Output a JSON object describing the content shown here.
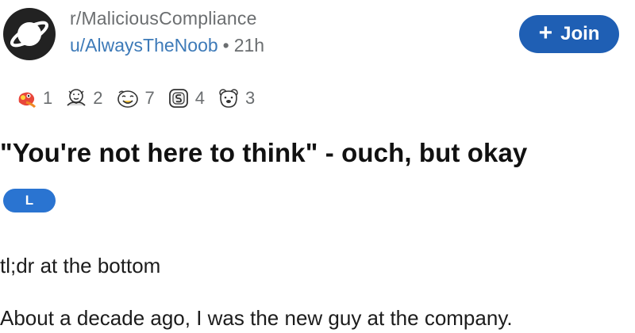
{
  "header": {
    "subreddit": "r/MaliciousCompliance",
    "author": "u/AlwaysTheNoob",
    "separator": "•",
    "age": "21h",
    "join_label": "Join",
    "join_icon": "plus-icon"
  },
  "awards": [
    {
      "icon": "wholesome-seal-award-icon",
      "count": "1"
    },
    {
      "icon": "hug-award-icon",
      "count": "2"
    },
    {
      "icon": "smiling-face-award-icon",
      "count": "7"
    },
    {
      "icon": "snek-coin-award-icon",
      "count": "4"
    },
    {
      "icon": "bear-face-award-icon",
      "count": "3"
    }
  ],
  "post": {
    "title": "\"You're not here to think\" - ouch, but okay",
    "flair": "L",
    "body_lines": [
      "tl;dr at the bottom",
      "About a decade ago, I was the new guy at the company."
    ]
  },
  "colors": {
    "join_bg": "#1f5fb4",
    "flair_bg": "#2a74d1",
    "username": "#3d7ab8",
    "meta_text": "#6b6e70"
  }
}
